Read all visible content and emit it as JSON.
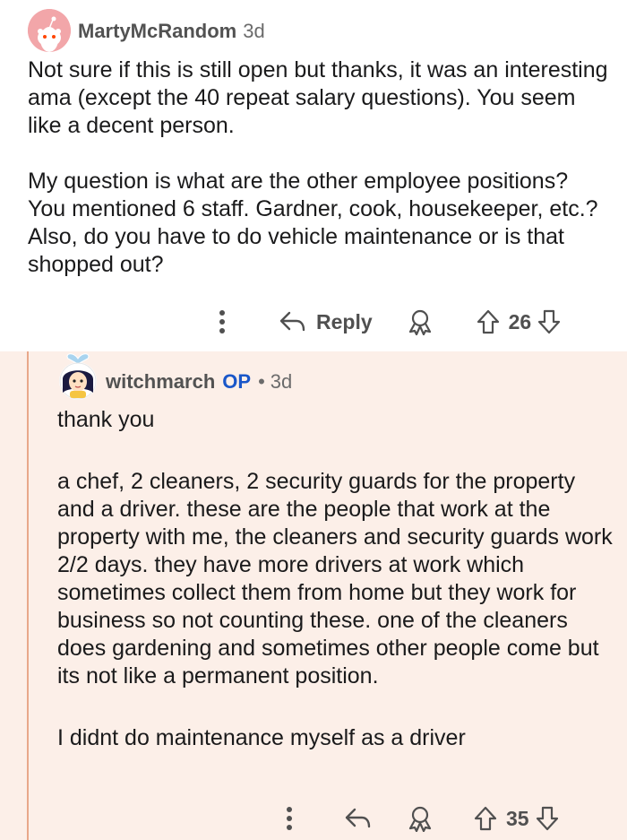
{
  "comment1": {
    "username": "MartyMcRandom",
    "age": "3d",
    "paragraphs": [
      "Not sure if this is still open but thanks, it was an interesting ama (except the 40 repeat salary questions). You seem like a decent person.",
      "My question is what are the other employee positions? You mentioned 6 staff. Gardner, cook, housekeeper, etc.? Also, do you have to do vehicle maintenance or is that shopped out?"
    ],
    "reply_label": "Reply",
    "votes": "26"
  },
  "comment2": {
    "username": "witchmarch",
    "op_badge": "OP",
    "separator": "•",
    "age": "3d",
    "paragraphs": [
      "thank you",
      "a chef, 2 cleaners, 2 security guards for the property and a driver. these are the people that work at the property with me, the cleaners and security guards work 2/2 days. they have more drivers at work which sometimes collect them from home but they work for business so not counting these. one of the cleaners does gardening and sometimes other people come but its not like a permanent position.",
      "I didnt do maintenance myself as a driver"
    ],
    "votes": "35"
  },
  "colors": {
    "reply_background": "#fcefe8",
    "thread_line": "#e8a88a",
    "op_badge": "#1a57c9"
  }
}
